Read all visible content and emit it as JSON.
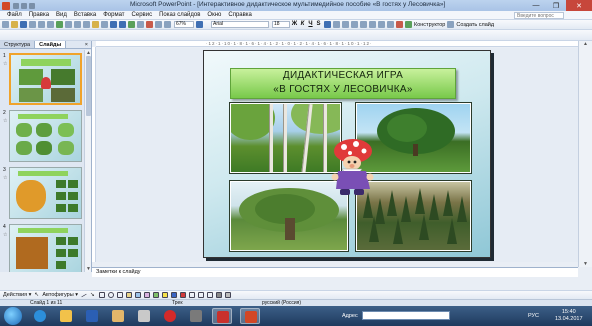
{
  "window": {
    "title": "Microsoft PowerPoint - [Интерактивное дидактическое мультимедийное пособие «В гостях у Лесовичка»]",
    "min": "—",
    "max": "❐",
    "close": "✕"
  },
  "menu": {
    "items": [
      "Файл",
      "Правка",
      "Вид",
      "Вставка",
      "Формат",
      "Сервис",
      "Показ слайдов",
      "Окно",
      "Справка"
    ],
    "help_placeholder": "Введите вопрос"
  },
  "toolbar": {
    "zoom": "67%",
    "font_name": "Arial",
    "font_size": "18",
    "bold": "Ж",
    "italic": "К",
    "underline": "Ч",
    "shadow": "S",
    "designer": "Конструктор",
    "create_slide": "Создать слайд"
  },
  "left_panel": {
    "tabs": [
      "Структура",
      "Слайды"
    ],
    "close": "×",
    "slide_numbers": [
      "1",
      "2",
      "3",
      "4",
      "5"
    ],
    "star": "☆"
  },
  "ruler": {
    "marks": "·12·1·10·1·8·1·6·1·4·1·2·1·0·1·2·1·4·1·6·1·8·1·10·1·12·"
  },
  "slide": {
    "title_line1": "ДИДАКТИЧЕСКАЯ ИГРА",
    "title_line2": "«В ГОСТЯХ У ЛЕСОВИЧКА»"
  },
  "notes": {
    "placeholder": "Заметки к слайду"
  },
  "drawing": {
    "actions": "Действия ▾",
    "autoshapes": "Автофигуры ▾"
  },
  "status": {
    "slide": "Слайд 1 из 11",
    "design": "Трек",
    "language": "русский (Россия)"
  },
  "taskbar": {
    "address_label": "Адрес",
    "lang": "РУС",
    "time": "15:40",
    "date": "13.04.2017"
  }
}
